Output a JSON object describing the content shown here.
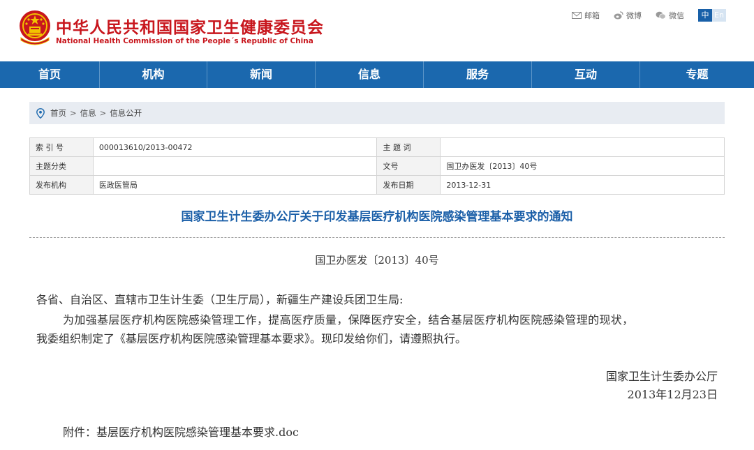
{
  "header": {
    "site_title": "中华人民共和国国家卫生健康委员会",
    "site_subtitle": "National Health Commission of the People´s Republic of China",
    "links": {
      "mail": "邮箱",
      "weibo": "微博",
      "wechat": "微信"
    },
    "lang": {
      "zh": "中",
      "en": "En"
    },
    "colors": {
      "brand_red": "#c8161d",
      "nav_blue": "#1b68ae"
    }
  },
  "nav": {
    "items": [
      {
        "label": "首页"
      },
      {
        "label": "机构"
      },
      {
        "label": "新闻"
      },
      {
        "label": "信息"
      },
      {
        "label": "服务"
      },
      {
        "label": "互动"
      },
      {
        "label": "专题"
      }
    ]
  },
  "breadcrumb": {
    "items": [
      "首页",
      "信息",
      "信息公开"
    ],
    "separator": ">"
  },
  "info_table": {
    "rows": [
      {
        "k1": "索 引 号",
        "v1": "000013610/2013-00472",
        "k2": "主 题 词",
        "v2": ""
      },
      {
        "k1": "主题分类",
        "v1": "",
        "k2": "文号",
        "v2": "国卫办医发〔2013〕40号"
      },
      {
        "k1": "发布机构",
        "v1": "医政医管局",
        "k2": "发布日期",
        "v2": "2013-12-31"
      }
    ]
  },
  "article": {
    "title": "国家卫生计生委办公厅关于印发基层医疗机构医院感染管理基本要求的通知",
    "serial": "国卫办医发〔2013〕40号",
    "addressee": "各省、自治区、直辖市卫生计生委（卫生厅局），新疆生产建设兵团卫生局:",
    "paragraph_line1": "为加强基层医疗机构医院感染管理工作，提高医疗质量，保障医疗安全，结合基层医疗机构医院感染管理的现状，",
    "paragraph_line2": "我委组织制定了《基层医疗机构医院感染管理基本要求》。现印发给你们，请遵照执行。",
    "sign_org": "国家卫生计生委办公厅",
    "sign_date": "2013年12月23日",
    "attachment": "附件：基层医疗机构医院感染管理基本要求.doc"
  }
}
